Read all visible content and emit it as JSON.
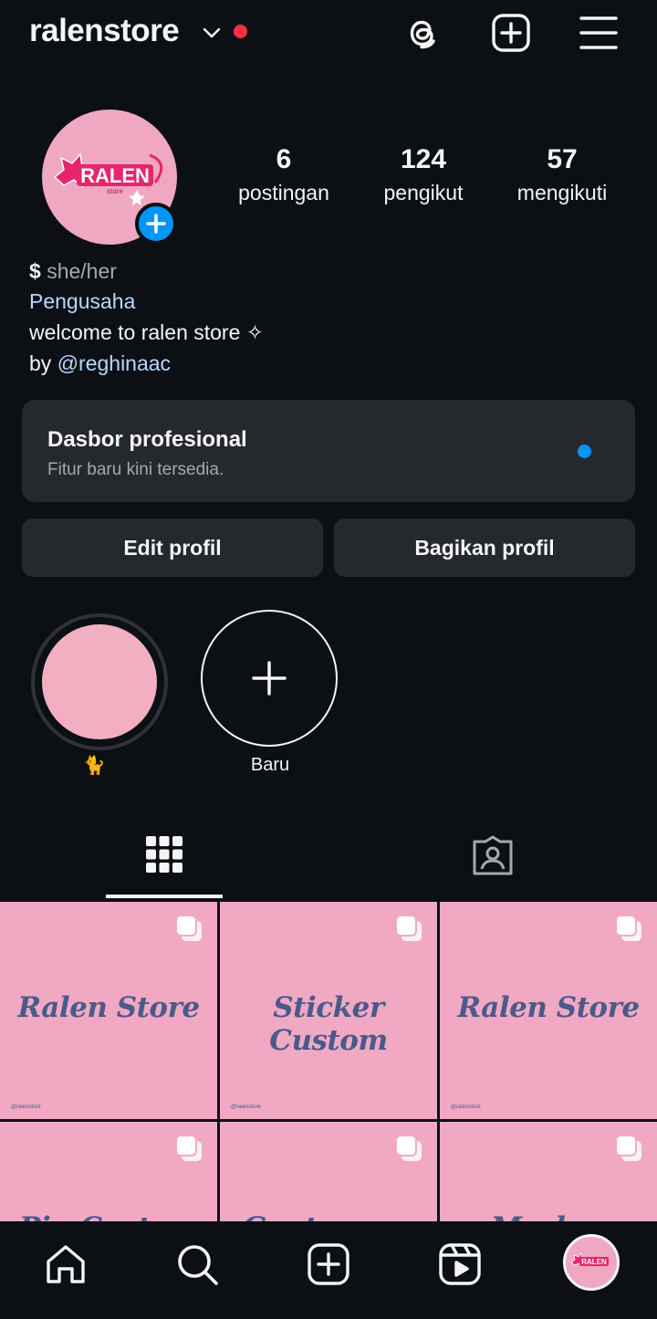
{
  "header": {
    "username": "ralenstore",
    "icons": [
      "chevron-down-icon",
      "threads-icon",
      "add-post-icon",
      "menu-icon"
    ],
    "notification_color": "#ff3040"
  },
  "profile": {
    "avatar_text": "RALEN",
    "avatar_subtext": "store",
    "stats": [
      {
        "value": "6",
        "label": "postingan"
      },
      {
        "value": "124",
        "label": "pengikut"
      },
      {
        "value": "57",
        "label": "mengikuti"
      }
    ],
    "pronouns_symbol": "$",
    "pronouns": "she/her",
    "category": "Pengusaha",
    "bio_line": "welcome to ralen store ✧",
    "by_prefix": "by",
    "by_handle": "@reghinaac"
  },
  "dashboard": {
    "title": "Dasbor profesional",
    "subtitle": "Fitur baru kini tersedia.",
    "dot_color": "#0095f6"
  },
  "actions": {
    "edit": "Edit profil",
    "share": "Bagikan profil"
  },
  "highlights": [
    {
      "caption": "🐈"
    },
    {
      "caption": "Baru"
    }
  ],
  "tabs": [
    "grid-icon",
    "tagged-icon"
  ],
  "posts": [
    {
      "title": "Ralen Store",
      "handle": "@ralenstore"
    },
    {
      "title": "Sticker Custom",
      "handle": "@ralenstore"
    },
    {
      "title": "Ralen Store",
      "handle": "@ralenstore"
    },
    {
      "title": "Pin Custom",
      "handle": ""
    },
    {
      "title": "Gantungan",
      "handle": ""
    },
    {
      "title": "Masker",
      "handle": ""
    }
  ],
  "accent_pink": "#f1a8c3",
  "nav": [
    "home-icon",
    "search-icon",
    "create-icon",
    "reels-icon",
    "profile-avatar"
  ]
}
